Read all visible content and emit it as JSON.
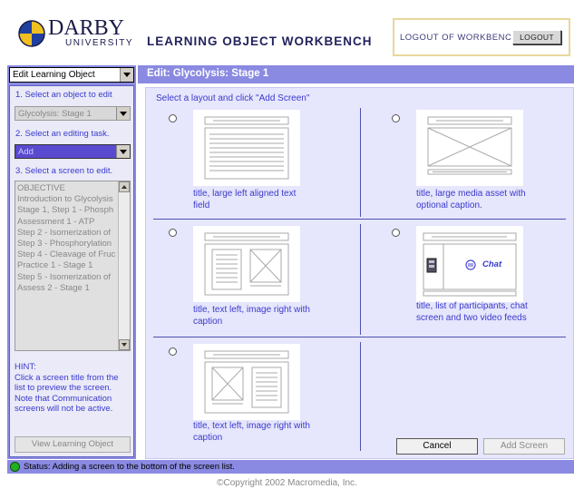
{
  "header": {
    "logo_word": "DARBY",
    "logo_sub": "UNIVERSITY",
    "app_title": "LEARNING OBJECT WORKBENCH",
    "logout_text": "LOGOUT OF WORKBENCH",
    "logout_button": "LOGOUT"
  },
  "left_panel": {
    "mode_select": "Edit Learning Object",
    "step1_label": "1. Select an object to edit",
    "object_select": "Glycolysis: Stage 1",
    "step2_label": "2. Select an editing task.",
    "task_select": "Add",
    "step3_label": "3. Select a screen to edit.",
    "screen_list": [
      "OBJECTIVE",
      "Introduction to Glycolysis",
      "Stage 1, Step 1 - Phosph",
      "Assessment 1 - ATP",
      "Step 2 - Isomerization of",
      "Step 3 - Phosphorylation",
      "Step 4 - Cleavage of Fruc",
      "Practice 1 - Stage 1",
      "Step 5 - Isomerization of",
      "Assess 2 - Stage 1"
    ],
    "hint_title": "HINT:",
    "hint_body": "Click a screen title from the list to preview the screen. Note that Communication screens will not be active.",
    "view_button": "View Learning Object"
  },
  "main": {
    "title": "Edit: Glycolysis: Stage 1",
    "instructions": "Select a layout and click \"Add Screen\"",
    "layouts": [
      {
        "caption_line1": "title, large left aligned text",
        "caption_line2": "field",
        "selected": false
      },
      {
        "caption_line1": "title, large media asset with",
        "caption_line2": "optional caption.",
        "selected": false
      },
      {
        "caption_line1": "title, text left, image right with",
        "caption_line2": "caption",
        "selected": false
      },
      {
        "caption_line1": "title, list of participants, chat",
        "caption_line2": "screen and two video feeds",
        "chat_label": "Chat",
        "selected": false
      },
      {
        "caption_line1": "title, text left,  image right with",
        "caption_line2": "caption",
        "selected": false
      }
    ],
    "cancel_button": "Cancel",
    "add_button": "Add Screen"
  },
  "status": {
    "text": "Status:  Adding a screen to the bottom of the screen list."
  },
  "footer": {
    "copyright": "©Copyright 2002 Macromedia, Inc."
  },
  "colors": {
    "panel_bg": "#8a8ae2",
    "main_bg": "#e6e6fc",
    "link_text": "#3a3acc",
    "status_ok": "#20b020"
  }
}
